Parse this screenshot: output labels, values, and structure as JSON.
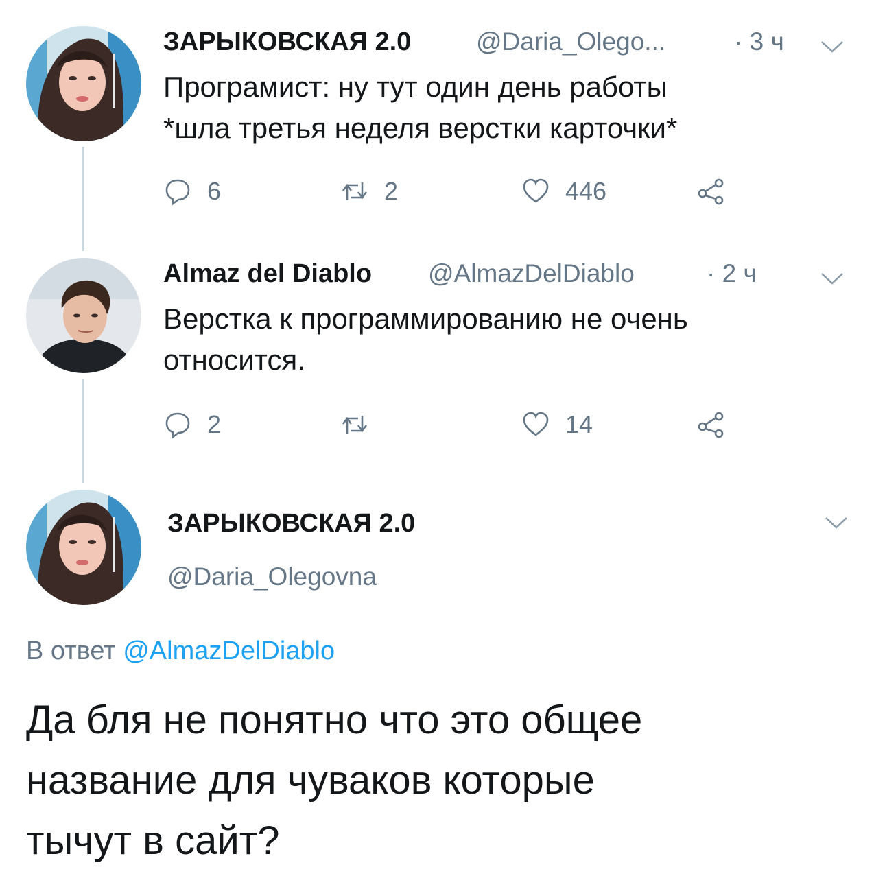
{
  "tweets": [
    {
      "name": "ЗАРЫКОВСКАЯ 2.0",
      "handle": "@Daria_Olego...",
      "time": "· 3 ч",
      "lines": [
        "Програмист: ну тут один день работы",
        "*шла третья неделя верстки карточки*"
      ],
      "replies": "6",
      "retweets": "2",
      "likes": "446"
    },
    {
      "name": "Almaz del Diablo",
      "handle": "@AlmazDelDiablo",
      "time": "· 2 ч",
      "lines": [
        "Верстка к программированию не очень",
        "относится."
      ],
      "replies": "2",
      "retweets": "",
      "likes": "14"
    }
  ],
  "main": {
    "name": "ЗАРЫКОВСКАЯ 2.0",
    "handle": "@Daria_Olegovna",
    "reply_prefix": "В ответ",
    "reply_to": "@AlmazDelDiablo",
    "lines": [
      "Да бля не понятно что это общее",
      "название для чуваков которые",
      "тычут в сайт?"
    ]
  },
  "colors": {
    "link": "#1da1f2",
    "muted": "#657786",
    "text": "#14171a",
    "line": "#ccd6dd"
  }
}
